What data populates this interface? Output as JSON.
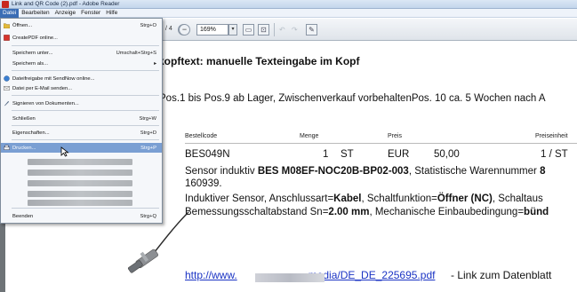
{
  "window": {
    "title": "Link and QR Code (2).pdf - Adobe Reader"
  },
  "menubar": {
    "items": [
      "Datei",
      "Bearbeiten",
      "Anzeige",
      "Fenster",
      "Hilfe"
    ]
  },
  "toolbar": {
    "page_total": "/ 4",
    "zoom": "169%"
  },
  "file_menu": {
    "items": [
      {
        "label": "Öffnen...",
        "shortcut": "Strg+O",
        "icon": "open-folder-icon"
      },
      {
        "label": "CreatePDF online...",
        "shortcut": "",
        "icon": "createpdf-icon"
      },
      {
        "label": "Speichern unter...",
        "shortcut": "Umschalt+Strg+S",
        "icon": ""
      },
      {
        "label": "Speichern als...",
        "shortcut": "▸",
        "icon": ""
      },
      {
        "label": "Dateifreigabe mit SendNow online...",
        "shortcut": "",
        "icon": "sendnow-icon"
      },
      {
        "label": "Datei per E-Mail senden...",
        "shortcut": "",
        "icon": "email-icon"
      },
      {
        "label": "Signieren von Dokumenten...",
        "shortcut": "",
        "icon": "sign-icon"
      },
      {
        "label": "Schließen",
        "shortcut": "Strg+W",
        "icon": ""
      },
      {
        "label": "Eigenschaften...",
        "shortcut": "Strg+D",
        "icon": ""
      },
      {
        "label": "Drucken...",
        "shortcut": "Strg+P",
        "icon": "printer-icon"
      },
      {
        "label": "Beenden",
        "shortcut": "Strg+Q",
        "icon": ""
      }
    ],
    "highlighted": "Drucken..."
  },
  "document": {
    "heading": "kopftext: manuelle Texteingabe im Kopf",
    "line1": "Pos.1 bis Pos.9 ab Lager, Zwischenverkauf vorbehaltenPos. 10 ca. 5 Wochen nach A",
    "columns": [
      "Bestellcode",
      "Menge",
      "Preis",
      "Preiseinheit"
    ],
    "row": {
      "code": "BES049N",
      "qty": "1",
      "unit": "ST",
      "currency": "EUR",
      "price": "50,00",
      "per": "1 / ST"
    },
    "desc1_a": "Sensor induktiv ",
    "desc1_b": "BES M08EF-NOC20B-BP02-003",
    "desc1_c": ", Statistische Warennummer ",
    "desc1_d": "8",
    "desc2": "160939.",
    "desc3_a": "Induktiver Sensor, Anschlussart=",
    "desc3_b": "Kabel",
    "desc3_c": ", Schaltfunktion=",
    "desc3_d": "Öffner (NC)",
    "desc3_e": ", Schaltaus",
    "desc4_a": "Bemessungsschaltabstand Sn=",
    "desc4_b": "2.00 mm",
    "desc4_c": ", Mechanische Einbaubedingung=",
    "desc4_d": "bünd",
    "link_start": "http://www.",
    "link_end": "media/DE_DE_225695.pdf",
    "link_after": " - Link zum Datenblatt"
  }
}
